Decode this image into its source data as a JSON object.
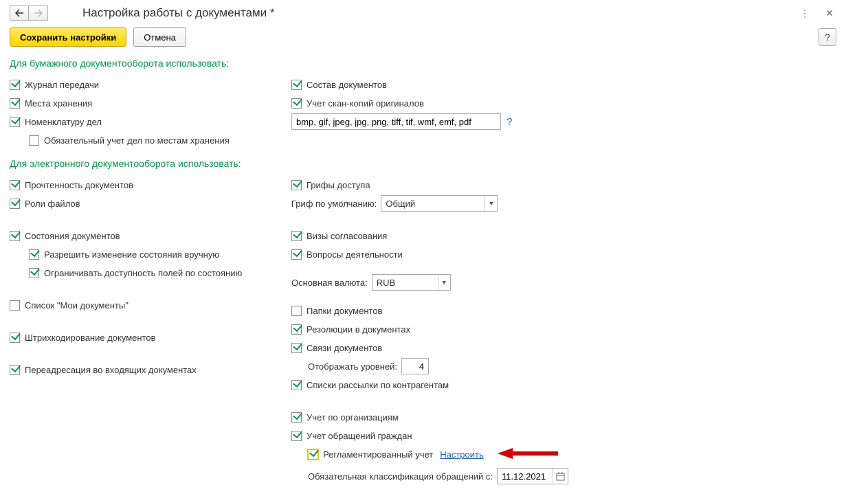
{
  "title": "Настройка работы с документами *",
  "toolbar": {
    "save": "Сохранить настройки",
    "cancel": "Отмена"
  },
  "section1": {
    "title": "Для бумажного документооборота использовать:",
    "left": {
      "transfer_log": "Журнал передачи",
      "storage_places": "Места хранения",
      "nomenclature": "Номенклатуру дел",
      "mandatory_storage": "Обязательный учет дел по местам хранения"
    },
    "right": {
      "doc_composition": "Состав документов",
      "scan_originals": "Учет скан-копий оригиналов",
      "formats_value": "bmp, gif, jpeg, jpg, png, tiff, tif, wmf, emf, pdf"
    }
  },
  "section2": {
    "title": "Для электронного документооборота использовать:",
    "left": {
      "read_docs": "Прочтенность документов",
      "file_roles": "Роли файлов",
      "doc_states": "Состояния документов",
      "allow_manual_state": "Разрешить изменение состояния вручную",
      "restrict_fields": "Ограничивать доступность полей по состоянию",
      "my_docs_list": "Список \"Мои документы\"",
      "barcoding": "Штрихкодирование документов",
      "forwarding": "Переадресация во входящих документах"
    },
    "right": {
      "access_stamps": "Грифы доступа",
      "default_stamp_label": "Гриф по умолчанию:",
      "default_stamp_value": "Общий",
      "approval_visas": "Визы согласования",
      "activity_questions": "Вопросы деятельности",
      "base_currency_label": "Основная валюта:",
      "base_currency_value": "RUB",
      "doc_folders": "Папки документов",
      "resolutions": "Резолюции в документах",
      "doc_links": "Связи документов",
      "show_levels_label": "Отображать уровней:",
      "show_levels_value": "4",
      "mailing_lists": "Списки рассылки по контрагентам",
      "org_accounting": "Учет по организациям",
      "citizen_requests": "Учет обращений граждан",
      "regulated_accounting": "Регламентированный учет",
      "configure_link": "Настроить",
      "mandatory_classification_label": "Обязательная классификация обращений с:",
      "mandatory_classification_value": "11.12.2021"
    }
  }
}
